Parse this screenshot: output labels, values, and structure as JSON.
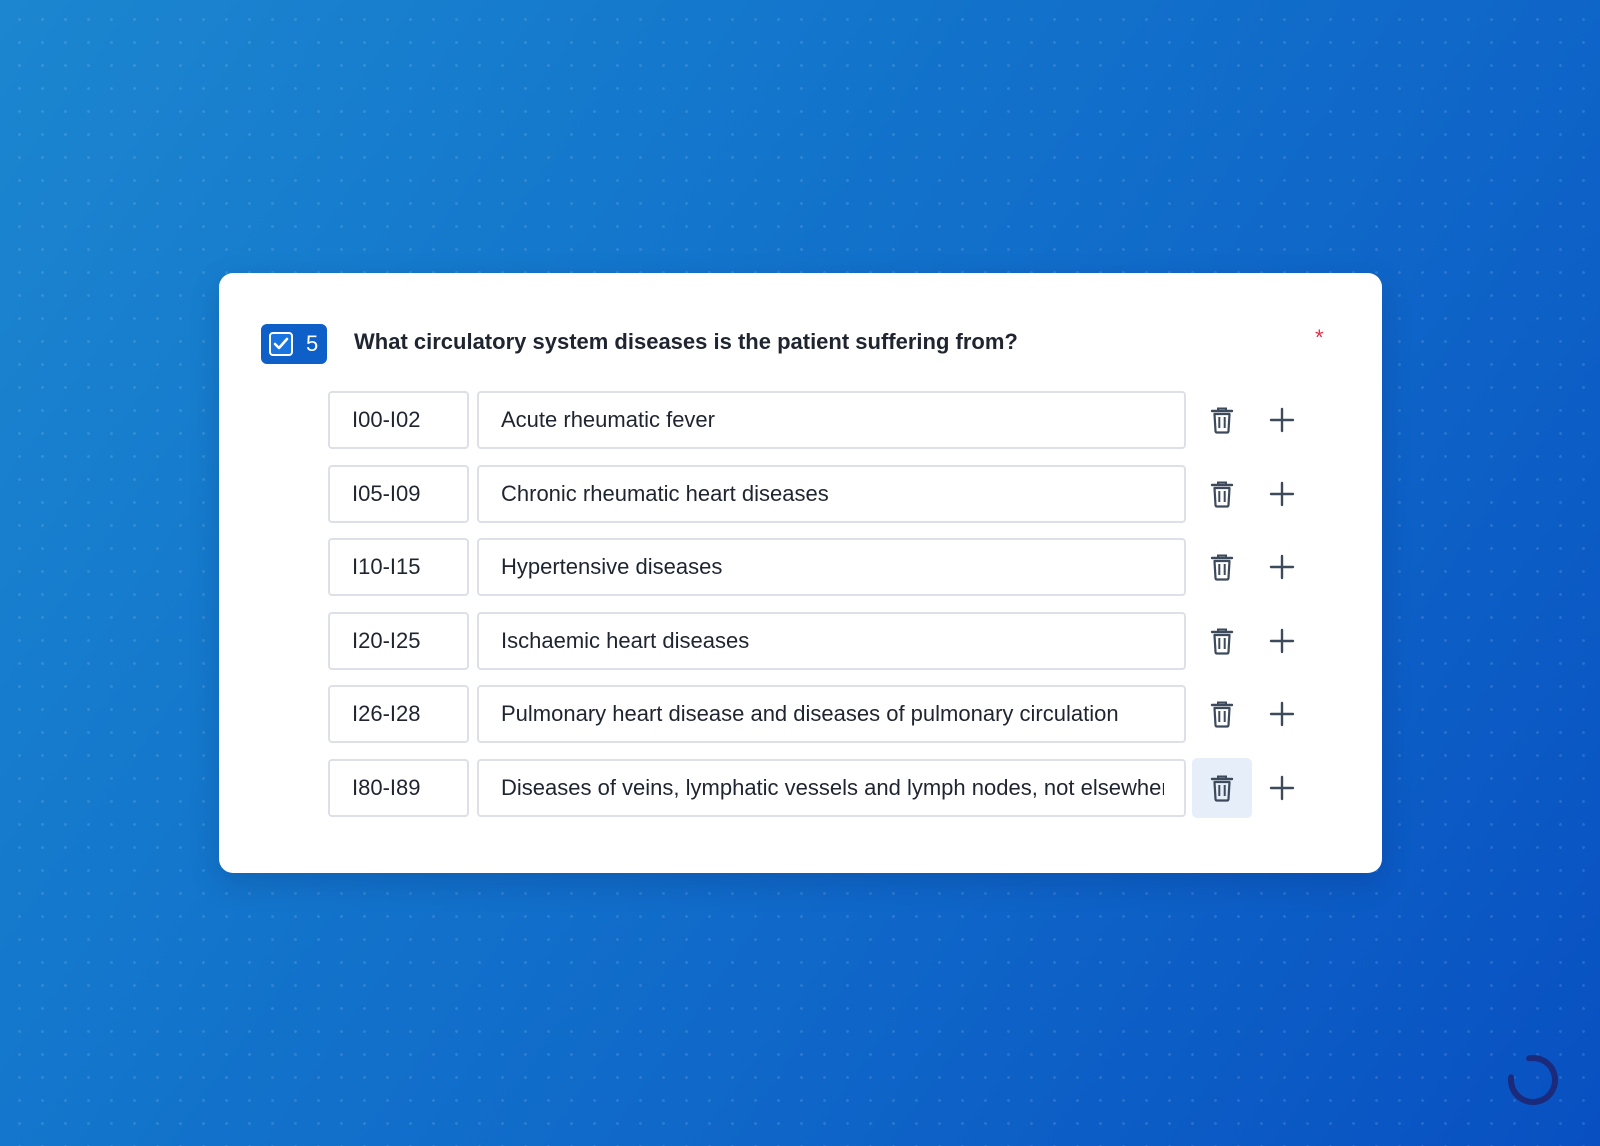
{
  "question": {
    "number": "5",
    "text": "What circulatory system diseases is the patient suffering from?",
    "required_marker": "*",
    "badge_icon": "checkbox-checked-icon"
  },
  "rows": [
    {
      "code": "I00-I02",
      "description": "Acute rheumatic fever"
    },
    {
      "code": "I05-I09",
      "description": "Chronic rheumatic heart diseases"
    },
    {
      "code": "I10-I15",
      "description": "Hypertensive diseases"
    },
    {
      "code": "I20-I25",
      "description": "Ischaemic heart diseases"
    },
    {
      "code": "I26-I28",
      "description": "Pulmonary heart disease and diseases of pulmonary circulation"
    },
    {
      "code": "I80-I89",
      "description": "Diseases of veins, lymphatic vessels and lymph nodes, not elsewhere classified",
      "trash_hovered": true
    }
  ],
  "row_actions": {
    "delete_icon": "trash-icon",
    "add_icon": "plus-icon"
  },
  "colors": {
    "background_start": "#1c86d0",
    "background_end": "#0850c2",
    "badge": "#0f5fc8",
    "required": "#e0304a",
    "text": "#1f2530",
    "icon": "#3d4a5c",
    "hover": "#e6eef9"
  },
  "corner_icon": "loading-ring-icon"
}
